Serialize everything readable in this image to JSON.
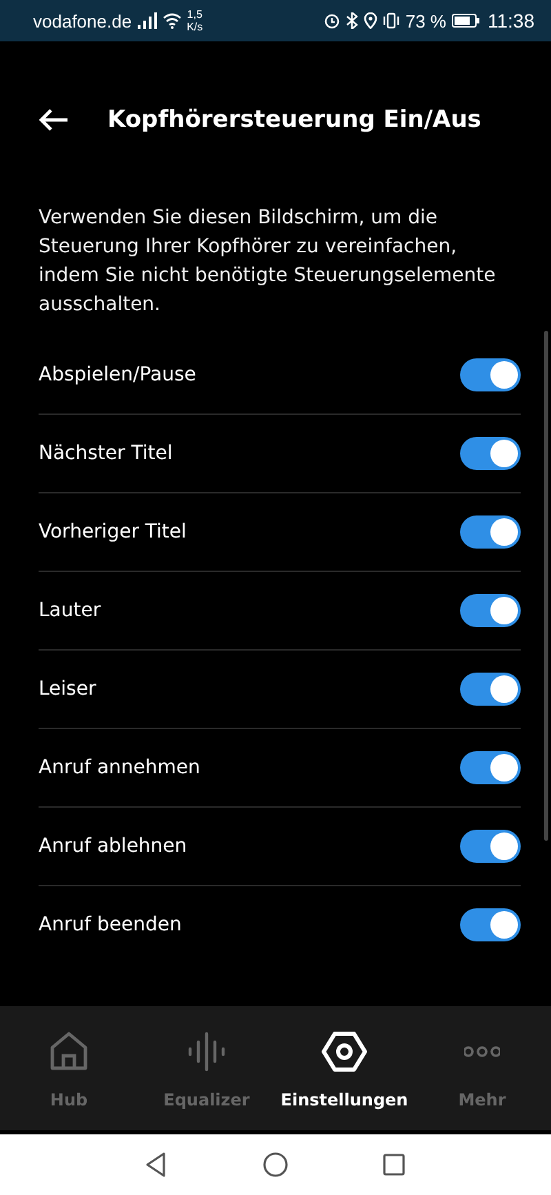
{
  "status_bar": {
    "carrier": "vodafone.de",
    "speed_value": "1,5",
    "speed_unit": "K/s",
    "battery": "73 %",
    "time": "11:38"
  },
  "header": {
    "title": "Kopfhörersteuerung Ein/Aus"
  },
  "description": "Verwenden Sie diesen Bildschirm, um die Steuerung Ihrer Kopfhörer zu vereinfachen, indem Sie nicht benötigte Steuerungselemente ausschalten.",
  "settings": [
    {
      "label": "Abspielen/Pause",
      "on": true
    },
    {
      "label": "Nächster Titel",
      "on": true
    },
    {
      "label": "Vorheriger Titel",
      "on": true
    },
    {
      "label": "Lauter",
      "on": true
    },
    {
      "label": "Leiser",
      "on": true
    },
    {
      "label": "Anruf annehmen",
      "on": true
    },
    {
      "label": "Anruf ablehnen",
      "on": true
    },
    {
      "label": "Anruf beenden",
      "on": true
    }
  ],
  "bottom_nav": [
    {
      "label": "Hub",
      "kind": "home",
      "selected": false
    },
    {
      "label": "Equalizer",
      "kind": "equalizer",
      "selected": false
    },
    {
      "label": "Einstellungen",
      "kind": "settings",
      "selected": true
    },
    {
      "label": "Mehr",
      "kind": "more",
      "selected": false
    }
  ]
}
